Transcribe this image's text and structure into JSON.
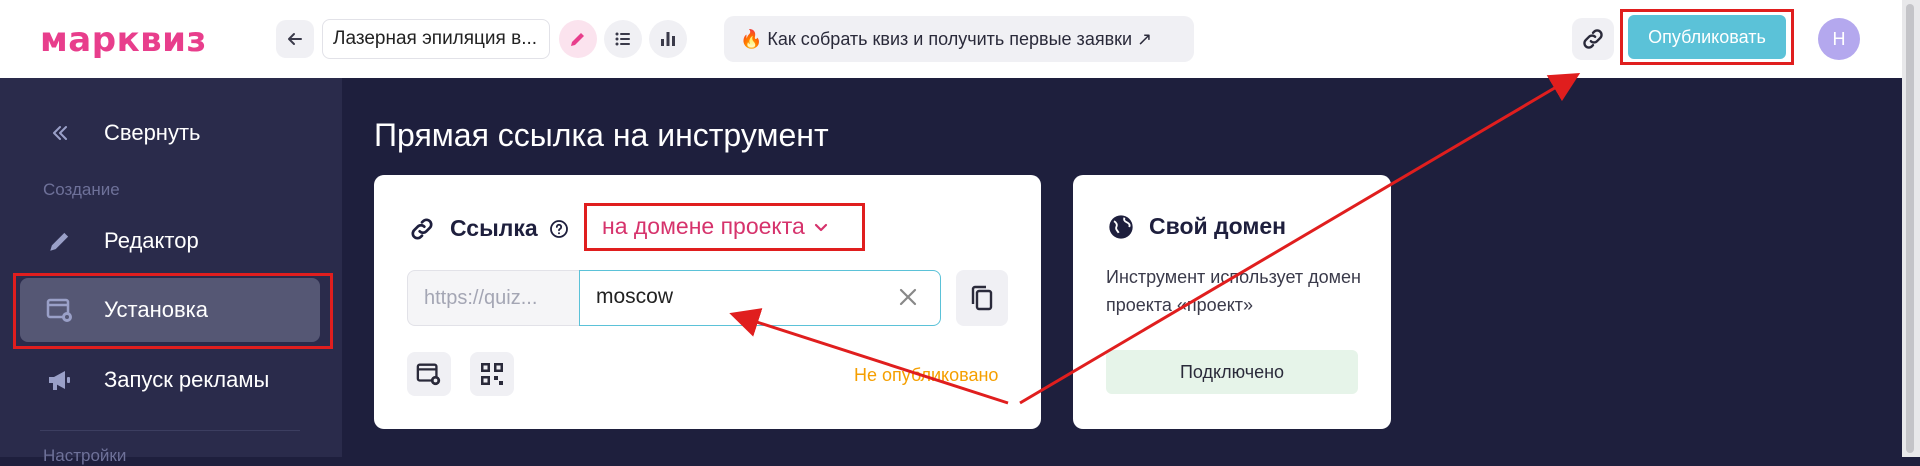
{
  "header": {
    "logo": "марквиз",
    "quiz_name": "Лазерная эпиляция в...",
    "promo": "🔥 Как собрать квиз и получить первые заявки ↗",
    "publish_label": "Опубликовать",
    "avatar_initial": "Н"
  },
  "sidebar": {
    "collapse_label": "Свернуть",
    "section_create": "Создание",
    "items": [
      {
        "label": "Редактор",
        "icon": "pencil-icon"
      },
      {
        "label": "Установка",
        "icon": "install-window-icon",
        "active": true
      },
      {
        "label": "Запуск рекламы",
        "icon": "megaphone-icon"
      }
    ],
    "section_settings": "Настройки"
  },
  "main": {
    "title": "Прямая ссылка на инструмент",
    "link_card": {
      "label": "Ссылка",
      "domain_option": "на домене проекта",
      "url_prefix": "https://quiz...",
      "url_value": "moscow",
      "status": "Не опубликовано"
    },
    "own_domain_card": {
      "title": "Свой домен",
      "description": "Инструмент использует домен проекта «проект»",
      "button_label": "Подключено"
    }
  },
  "colors": {
    "brand": "#e83e8c",
    "publish": "#5bc2d8",
    "sidebar_bg": "#2a2b4b",
    "main_bg": "#1e1f3d",
    "highlight": "#e01e1e",
    "status_unpublished": "#f59f00"
  }
}
